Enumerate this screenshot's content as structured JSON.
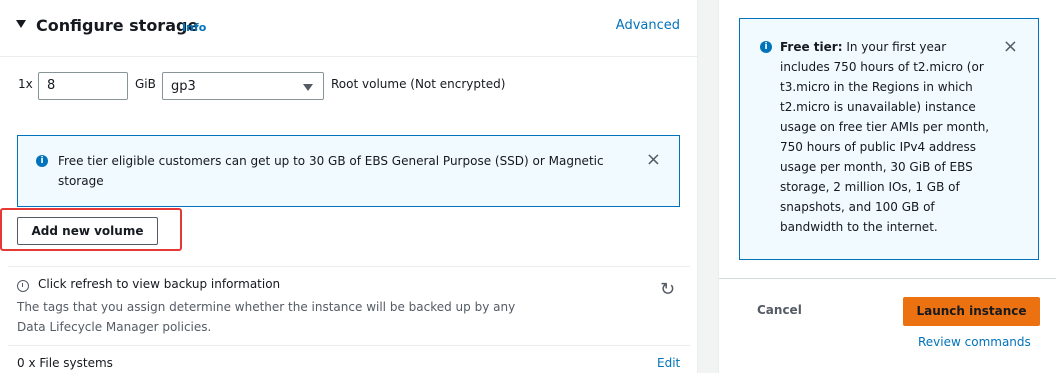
{
  "storage": {
    "title": "Configure storage",
    "info_label": "Info",
    "advanced_label": "Advanced",
    "volume": {
      "multiplier": "1x",
      "size": "8",
      "unit": "GiB",
      "type": "gp3",
      "description": "Root volume  (Not encrypted)"
    },
    "alert": {
      "text": "Free tier eligible customers can get up to 30 GB of EBS General Purpose (SSD) or Magnetic storage"
    },
    "add_volume_label": "Add new volume",
    "backup": {
      "title": "Click refresh to view backup information",
      "description": "The tags that you assign determine whether the instance will be backed up by any Data Lifecycle Manager policies."
    },
    "file_systems_label": "0 x File systems",
    "edit_label": "Edit"
  },
  "summary": {
    "free_tier_title": "Free tier:",
    "free_tier_text": " In your first year includes 750 hours of t2.micro (or t3.micro in the Regions in which t2.micro is unavailable) instance usage on free tier AMIs per month, 750 hours of public IPv4 address usage per month, 30 GiB of EBS storage, 2 million IOs, 1 GB of snapshots, and 100 GB of bandwidth to the internet.",
    "cancel_label": "Cancel",
    "launch_label": "Launch instance",
    "review_label": "Review commands"
  },
  "icons": {
    "close": "×",
    "refresh": "↻",
    "info": "i"
  },
  "colors": {
    "link": "#0073bb",
    "primary_button": "#ec7211",
    "info_border": "#0073bb",
    "info_bg": "#f1faff",
    "highlight": "#e53935"
  }
}
